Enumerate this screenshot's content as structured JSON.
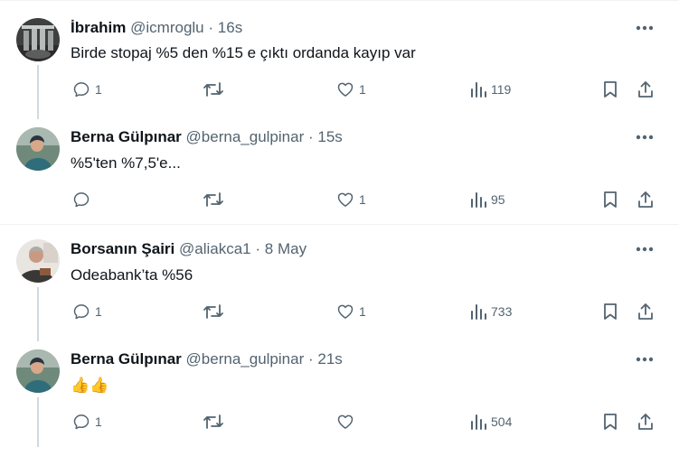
{
  "tweets": [
    {
      "name": "İbrahim",
      "handle": "@icmroglu",
      "dot": "·",
      "time": "16s",
      "text": "Birde stopaj %5 den %15 e çıktı ordanda kayıp var",
      "replies": "1",
      "retweets": "",
      "likes": "1",
      "views": "119"
    },
    {
      "name": "Berna Gülpınar",
      "handle": "@berna_gulpinar",
      "dot": "·",
      "time": "15s",
      "text": "%5'ten %7,5'e...",
      "replies": "",
      "retweets": "",
      "likes": "1",
      "views": "95"
    },
    {
      "name": "Borsanın Şairi",
      "handle": "@aliakca1",
      "dot": "·",
      "time": "8 May",
      "text": "Odeabank’ta %56",
      "replies": "1",
      "retweets": "",
      "likes": "1",
      "views": "733"
    },
    {
      "name": "Berna Gülpınar",
      "handle": "@berna_gulpinar",
      "dot": "·",
      "time": "21s",
      "text": "👍👍",
      "replies": "1",
      "retweets": "",
      "likes": "",
      "views": "504"
    }
  ],
  "colors": {
    "text": "#0f1419",
    "secondary": "#536471",
    "thread_line": "#cfd9de",
    "divider": "#eff3f4"
  },
  "icons": [
    "reply-icon",
    "retweet-icon",
    "like-icon",
    "views-icon",
    "bookmark-icon",
    "share-icon",
    "more-icon"
  ]
}
